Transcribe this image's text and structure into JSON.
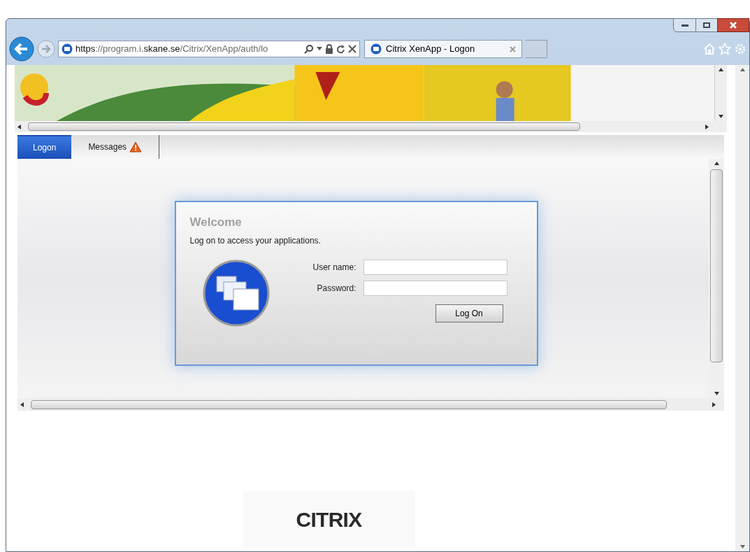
{
  "browser": {
    "url_scheme": "https",
    "url_host": "://program.i.",
    "url_domain": "skane.se",
    "url_path": "/Citrix/XenApp/auth/lo",
    "tabs": [
      {
        "title": "Citrix XenApp - Logon",
        "selected": true
      }
    ]
  },
  "tabs": [
    {
      "label": "Logon",
      "selected": true,
      "warning": false
    },
    {
      "label": "Messages",
      "selected": false,
      "warning": true
    }
  ],
  "dialog": {
    "title": "Welcome",
    "subtitle": "Log on to access your applications.",
    "fields": [
      {
        "label": "User name:"
      },
      {
        "label": "Password:"
      }
    ],
    "button": "Log On"
  },
  "footer": {
    "logo": "CITRIX"
  }
}
